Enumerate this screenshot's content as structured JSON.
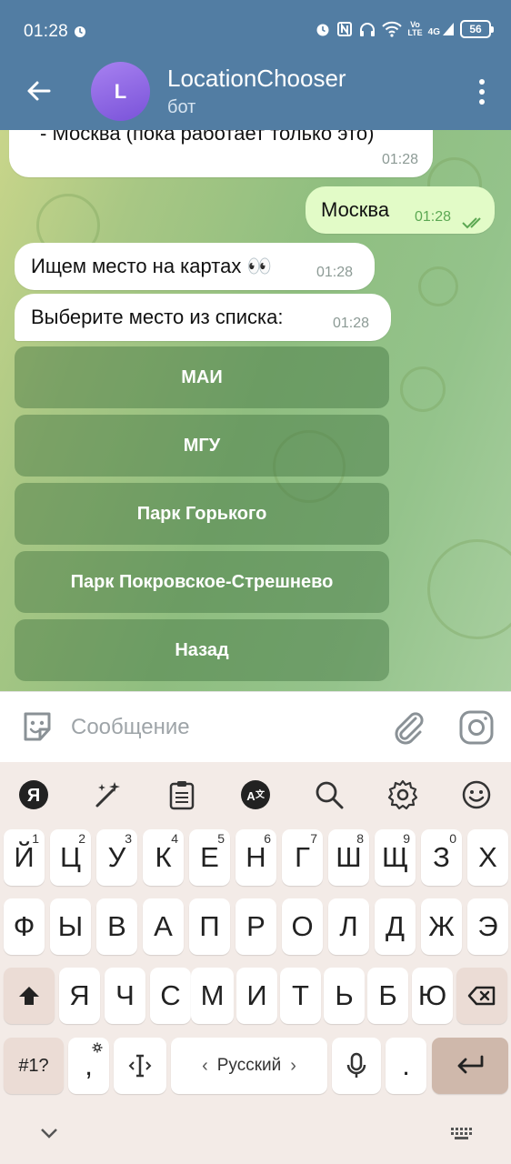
{
  "status_bar": {
    "time": "01:28",
    "network_badge_top": "Vo",
    "network_badge_bottom": "LTE",
    "net_type": "4G",
    "battery": "56"
  },
  "header": {
    "avatar_letter": "L",
    "title": "LocationChooser",
    "subtitle": "бот"
  },
  "messages": [
    {
      "direction": "in",
      "text": "- Москва (пока работает только это)",
      "time": "01:28"
    },
    {
      "direction": "out",
      "text": "Москва",
      "time": "01:28",
      "status": "read"
    },
    {
      "direction": "in",
      "text": "Ищем место на картах 👀",
      "time": "01:28"
    },
    {
      "direction": "in",
      "text": "Выберите место из списка:",
      "time": "01:28"
    }
  ],
  "reply_keyboard": [
    "МАИ",
    "МГУ",
    "Парк Горького",
    "Парк Покровское-Стрешнево",
    "Назад"
  ],
  "input": {
    "placeholder": "Сообщение",
    "value": ""
  },
  "keyboard": {
    "toolbar": [
      "yandex-icon",
      "magic-wand-icon",
      "clipboard-icon",
      "translate-icon",
      "search-icon",
      "settings-icon",
      "emoji-icon"
    ],
    "toolbar_logo": "Я",
    "row1": [
      "Й",
      "Ц",
      "У",
      "К",
      "Е",
      "Н",
      "Г",
      "Ш",
      "Щ",
      "З",
      "Х"
    ],
    "row1_digits": [
      "1",
      "2",
      "3",
      "4",
      "5",
      "6",
      "7",
      "8",
      "9",
      "0"
    ],
    "row2": [
      "Ф",
      "Ы",
      "В",
      "А",
      "П",
      "Р",
      "О",
      "Л",
      "Д",
      "Ж",
      "Э"
    ],
    "row3": [
      "Я",
      "Ч",
      "С",
      "М",
      "И",
      "Т",
      "Ь",
      "Б",
      "Ю"
    ],
    "symbols_key": "#1?",
    "comma_key": ",",
    "space_label": "Русский",
    "period_key": "."
  }
}
